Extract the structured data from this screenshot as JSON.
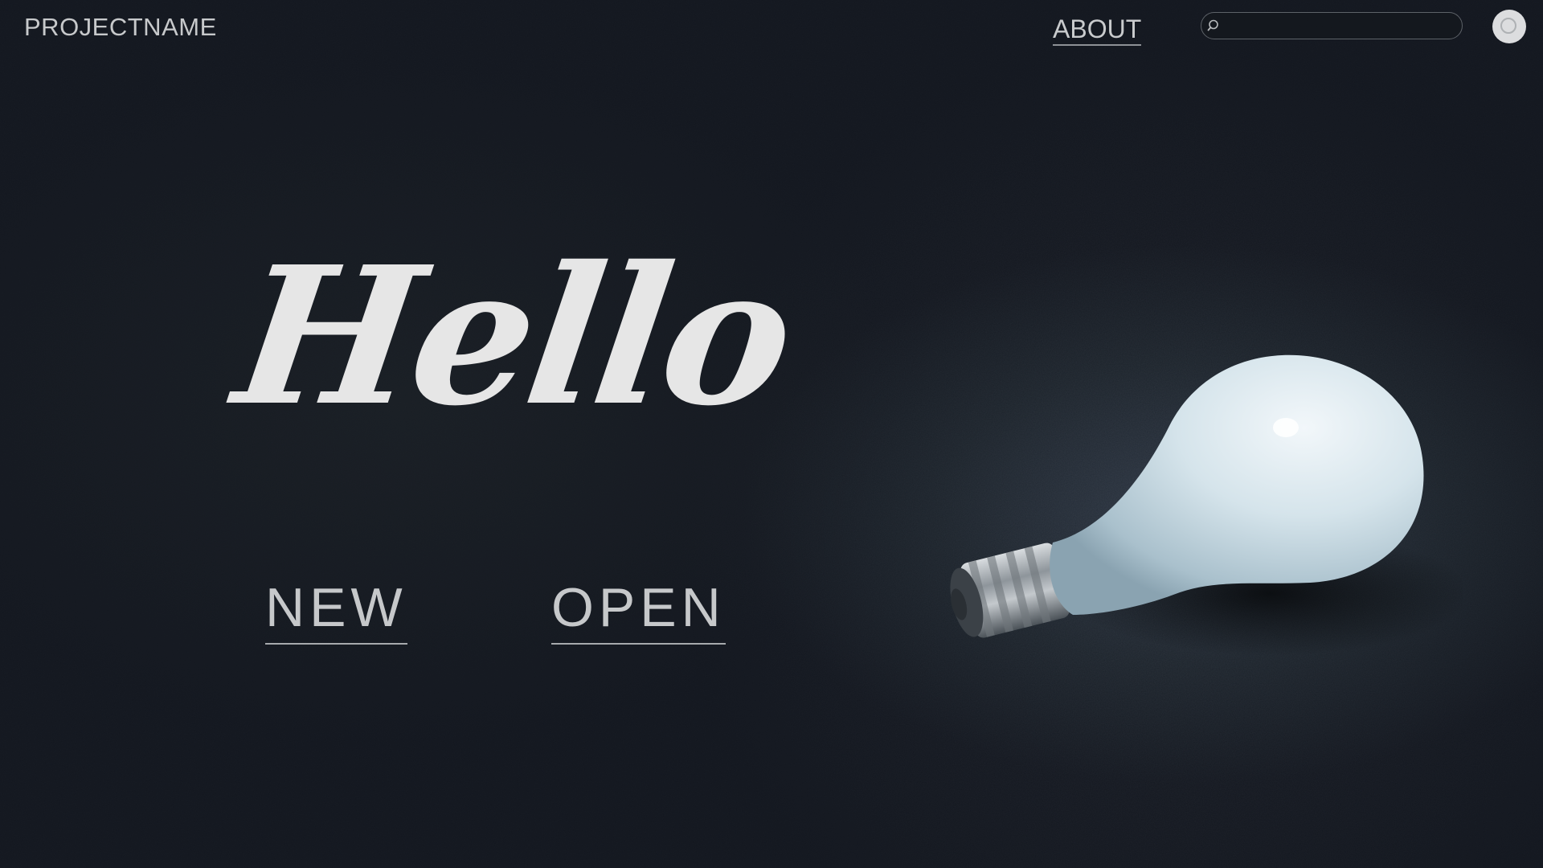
{
  "header": {
    "brand": "PROJECTNAME",
    "nav_about": "ABOUT",
    "search_placeholder": ""
  },
  "hero": {
    "title": "Hello",
    "actions": {
      "new_label": "NEW",
      "open_label": "OPEN"
    }
  },
  "icons": {
    "search": "search-icon",
    "avatar": "user-avatar-icon",
    "hero_image": "light-bulb-image"
  },
  "colors": {
    "background": "#151a1f",
    "text": "#c7c9cb",
    "title": "#e6e6e6",
    "bulb": "#d6e3ea"
  }
}
